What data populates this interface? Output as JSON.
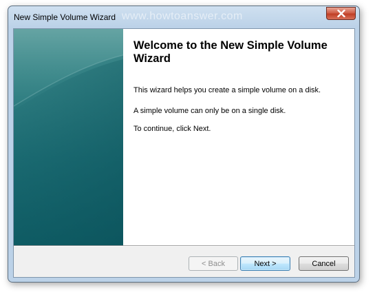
{
  "window": {
    "title": "New Simple Volume Wizard",
    "watermark": "www.howtoanswer.com"
  },
  "content": {
    "heading": "Welcome to the New Simple Volume Wizard",
    "paragraphs": [
      "This wizard helps you create a simple volume on a disk.",
      "A simple volume can only be on a single disk.",
      "To continue, click Next."
    ]
  },
  "buttons": {
    "back": "< Back",
    "next": "Next >",
    "cancel": "Cancel"
  },
  "colors": {
    "side_panel": "#1d6d74",
    "close_button": "#c8452c",
    "title_bar": "#bcd2e8"
  },
  "icons": {
    "close": "close-icon"
  }
}
